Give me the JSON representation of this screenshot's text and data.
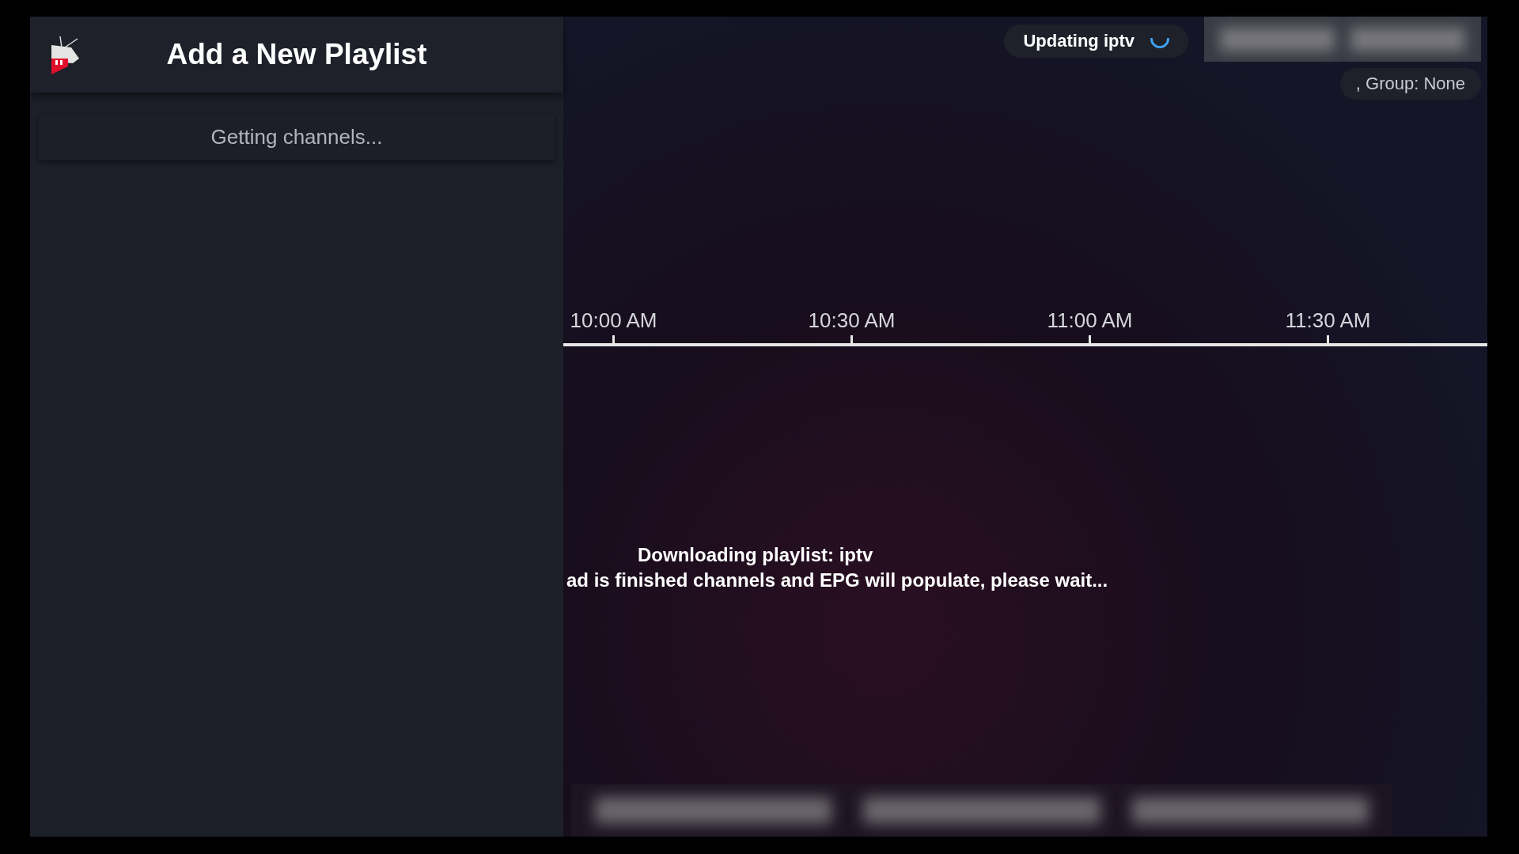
{
  "panel": {
    "title": "Add a New Playlist",
    "status": "Getting channels..."
  },
  "top_bar": {
    "update_chip": {
      "label": "Updating iptv"
    },
    "group_chip": {
      "label": ", Group: None"
    }
  },
  "timeline": {
    "times": [
      "10:00 AM",
      "10:30 AM",
      "11:00 AM",
      "11:30 AM"
    ]
  },
  "message": {
    "lines": [
      "Downloading playlist: iptv",
      "ad is finished channels and EPG will populate, please wait..."
    ]
  }
}
